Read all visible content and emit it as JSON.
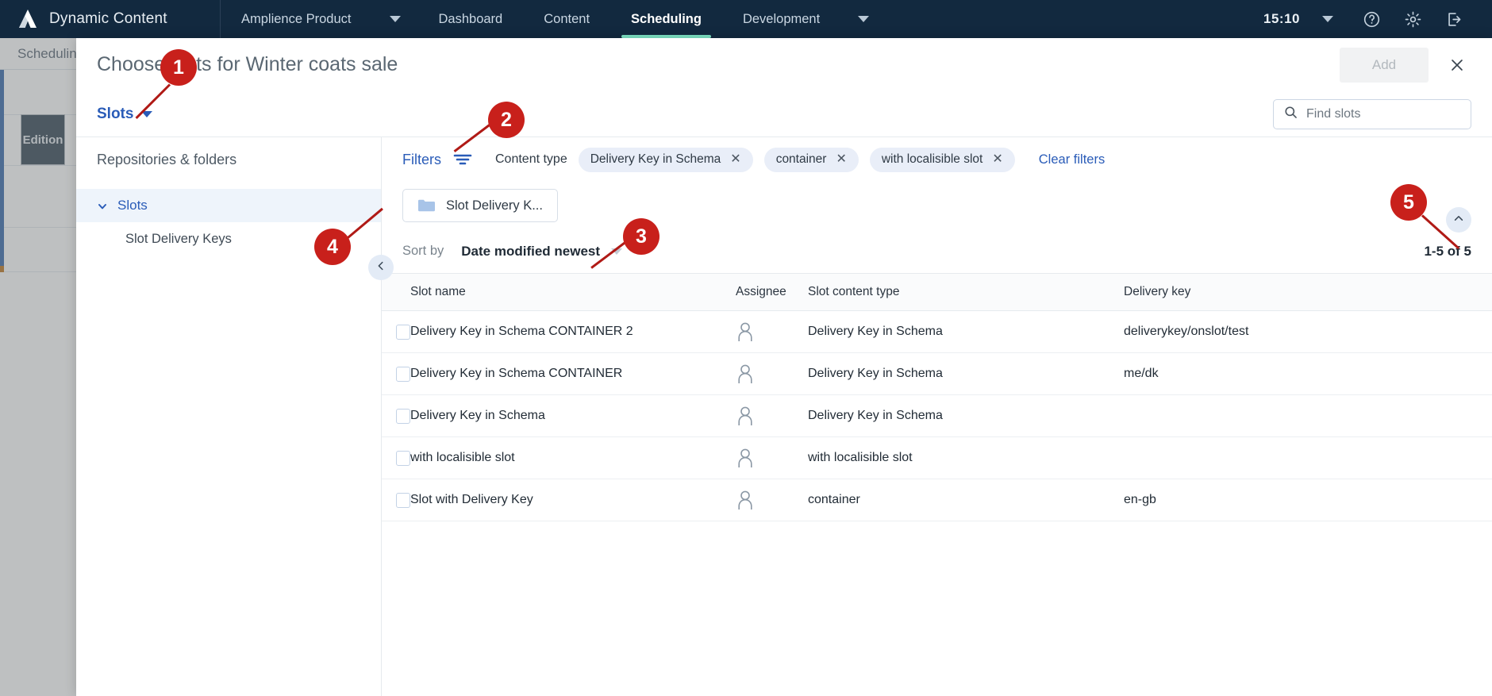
{
  "topnav": {
    "brand": "Dynamic Content",
    "logo_icon": "amplience-logo-icon",
    "account": "Amplience Product",
    "account_caret_icon": "chevron-down-icon",
    "items": [
      {
        "label": "Dashboard",
        "active": false
      },
      {
        "label": "Content",
        "active": false
      },
      {
        "label": "Scheduling",
        "active": true
      },
      {
        "label": "Development",
        "active": false
      }
    ],
    "overflow_caret_icon": "chevron-down-icon",
    "clock": "15:10",
    "clock_caret_icon": "chevron-down-icon",
    "help_icon": "help-circle-icon",
    "settings_icon": "gear-icon",
    "logout_icon": "logout-icon"
  },
  "background_page": {
    "header": "Scheduling",
    "edition_label": "Edition"
  },
  "modal": {
    "title": "Choose slots for Winter coats sale",
    "add_label": "Add",
    "close_icon": "close-icon",
    "type_selector": {
      "label": "Slots",
      "caret_icon": "chevron-down-icon"
    },
    "search": {
      "icon": "search-icon",
      "placeholder": "Find slots",
      "value": ""
    },
    "left_panel": {
      "title": "Repositories & folders",
      "collapse_icon": "chevron-left-icon",
      "tree": [
        {
          "label": "Slots",
          "level": 0,
          "selected": true,
          "expanded": true,
          "icon": "chevron-down-icon"
        },
        {
          "label": "Slot Delivery Keys",
          "level": 1,
          "selected": false
        }
      ]
    },
    "filters": {
      "label": "Filters",
      "icon": "filter-icon",
      "content_type_label": "Content type",
      "chips": [
        {
          "label": "Delivery Key in Schema",
          "remove_icon": "close-icon"
        },
        {
          "label": "container",
          "remove_icon": "close-icon"
        },
        {
          "label": "with localisible slot",
          "remove_icon": "close-icon"
        }
      ],
      "clear_label": "Clear filters"
    },
    "breadcrumb": {
      "folder_icon": "folder-icon",
      "label": "Slot Delivery K..."
    },
    "sort": {
      "label": "Sort by",
      "value": "Date modified newest",
      "caret_icon": "chevron-down-icon"
    },
    "pagination": {
      "range": "1-5 of 5",
      "scroll_icon": "chevron-up-icon"
    },
    "table": {
      "columns": [
        "Slot name",
        "Assignee",
        "Slot content type",
        "Delivery key"
      ],
      "rows": [
        {
          "checked": false,
          "name": "Delivery Key in Schema CONTAINER 2",
          "assignee_icon": "user-avatar-icon",
          "content_type": "Delivery Key in Schema",
          "delivery_key": "deliverykey/onslot/test"
        },
        {
          "checked": false,
          "name": "Delivery Key in Schema CONTAINER",
          "assignee_icon": "user-avatar-icon",
          "content_type": "Delivery Key in Schema",
          "delivery_key": "me/dk"
        },
        {
          "checked": false,
          "name": "Delivery Key in Schema",
          "assignee_icon": "user-avatar-icon",
          "content_type": "Delivery Key in Schema",
          "delivery_key": ""
        },
        {
          "checked": false,
          "name": "with localisible slot",
          "assignee_icon": "user-avatar-icon",
          "content_type": "with localisible slot",
          "delivery_key": ""
        },
        {
          "checked": false,
          "name": "Slot with Delivery Key",
          "assignee_icon": "user-avatar-icon",
          "content_type": "container",
          "delivery_key": "en-gb"
        }
      ]
    }
  },
  "callouts": [
    {
      "number": "1"
    },
    {
      "number": "2"
    },
    {
      "number": "3"
    },
    {
      "number": "4"
    },
    {
      "number": "5"
    }
  ],
  "colors": {
    "nav_background": "#12293f",
    "nav_active_underline": "#7de2c3",
    "link_blue": "#2a5cb8",
    "chip_background": "#e9eef8",
    "callout_red": "#c8201b"
  }
}
